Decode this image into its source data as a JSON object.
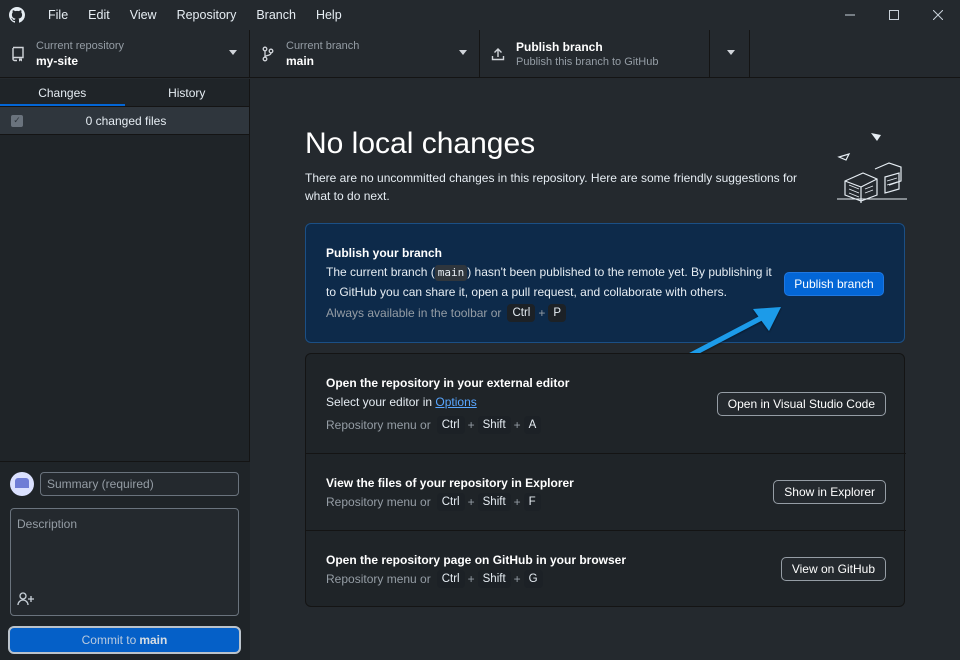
{
  "menu": [
    "File",
    "Edit",
    "View",
    "Repository",
    "Branch",
    "Help"
  ],
  "toolbar": {
    "repo_label": "Current repository",
    "repo_value": "my-site",
    "branch_label": "Current branch",
    "branch_value": "main",
    "publish_label": "Publish branch",
    "publish_sub": "Publish this branch to GitHub"
  },
  "sidebar": {
    "tabs": [
      "Changes",
      "History"
    ],
    "changed_files": "0 changed files"
  },
  "commit": {
    "summary_placeholder": "Summary (required)",
    "description_placeholder": "Description",
    "button_prefix": "Commit to",
    "button_branch": "main"
  },
  "main": {
    "title": "No local changes",
    "intro": "There are no uncommitted changes in this repository. Here are some friendly suggestions for what to do next.",
    "publish_card": {
      "title": "Publish your branch",
      "body_before": "The current branch (",
      "body_code": "main",
      "body_after": ") hasn't been published to the remote yet. By publishing it to GitHub you can share it, open a pull request, and collaborate with others.",
      "hint": "Always available in the toolbar or",
      "keys": [
        "Ctrl",
        "P"
      ],
      "button": "Publish branch"
    },
    "suggestions": [
      {
        "title": "Open the repository in your external editor",
        "sub_before": "Select your editor in",
        "sub_link": "Options",
        "hint": "Repository menu or",
        "keys": [
          "Ctrl",
          "Shift",
          "A"
        ],
        "button": "Open in Visual Studio Code"
      },
      {
        "title": "View the files of your repository in Explorer",
        "hint": "Repository menu or",
        "keys": [
          "Ctrl",
          "Shift",
          "F"
        ],
        "button": "Show in Explorer"
      },
      {
        "title": "Open the repository page on GitHub in your browser",
        "hint": "Repository menu or",
        "keys": [
          "Ctrl",
          "Shift",
          "G"
        ],
        "button": "View on GitHub"
      }
    ]
  },
  "colors": {
    "accent": "#0366d6",
    "callout_arrow": "#1e9be9",
    "publish_card_bg": "#0d2a4a"
  }
}
